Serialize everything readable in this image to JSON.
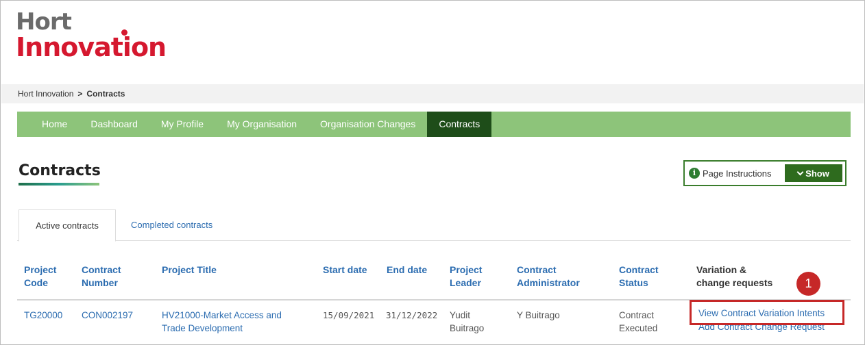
{
  "logo": {
    "line1": "Hort",
    "line2": "Innovation"
  },
  "breadcrumb": {
    "root": "Hort Innovation",
    "separator": ">",
    "current": "Contracts"
  },
  "nav": [
    "Home",
    "Dashboard",
    "My Profile",
    "My Organisation",
    "Organisation Changes",
    "Contracts"
  ],
  "nav_active": "Contracts",
  "page": {
    "title": "Contracts"
  },
  "instructions": {
    "label": "Page Instructions",
    "button": "Show"
  },
  "tabs": [
    {
      "label": "Active contracts",
      "active": true
    },
    {
      "label": "Completed contracts",
      "active": false
    }
  ],
  "table": {
    "headers": [
      [
        "Project",
        "Code"
      ],
      [
        "Contract",
        "Number"
      ],
      [
        "Project Title",
        ""
      ],
      [
        "Start date",
        ""
      ],
      [
        "End date",
        ""
      ],
      [
        "Project",
        "Leader"
      ],
      [
        "Contract",
        "Administrator"
      ],
      [
        "Contract",
        "Status"
      ],
      [
        "Variation &",
        "change requests"
      ]
    ],
    "rows": [
      {
        "project_code": "TG20000",
        "contract_number": "CON002197",
        "project_title": [
          "HV21000-Market Access and",
          "Trade Development"
        ],
        "start_date": "15/09/2021",
        "end_date": "31/12/2022",
        "project_leader": [
          "Yudit",
          "Buitrago"
        ],
        "contract_administrator": "Y Buitrago",
        "contract_status": [
          "Contract",
          "Executed"
        ],
        "actions": [
          "View Contract Variation Intents",
          "Add Contract Change Request"
        ]
      }
    ]
  },
  "annotation": {
    "number": "1",
    "color": "#c62828"
  },
  "colors": {
    "nav_bg": "#8dc47a",
    "nav_active": "#1e4d19",
    "link": "#2b6cb0",
    "brand_red": "#d5182f"
  }
}
